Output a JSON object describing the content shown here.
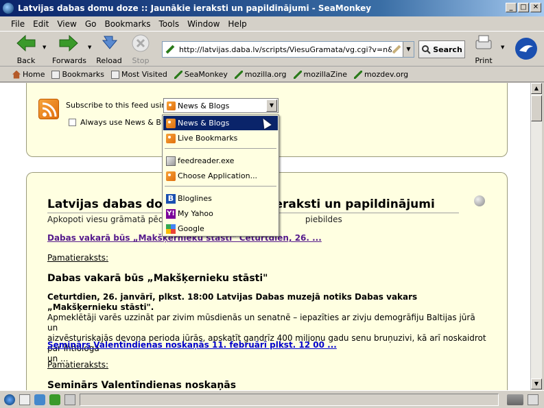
{
  "window": {
    "title": "Latvijas dabas domu doze :: Jaunākie ieraksti un papildinājumi - SeaMonkey"
  },
  "menu": [
    "File",
    "Edit",
    "View",
    "Go",
    "Bookmarks",
    "Tools",
    "Window",
    "Help"
  ],
  "nav": {
    "back": "Back",
    "forward": "Forwards",
    "reload": "Reload",
    "stop": "Stop",
    "print": "Print"
  },
  "url": {
    "value": "http://latvijas.daba.lv/scripts/ViesuGramata/vg.cgi?v=n&s=d&R"
  },
  "search": {
    "label": "Search"
  },
  "bookmarks": [
    "Home",
    "Bookmarks",
    "Most Visited",
    "SeaMonkey",
    "mozilla.org",
    "mozillaZine",
    "mozdev.org"
  ],
  "feed": {
    "subscribe_label": "Subscribe to this feed using",
    "selected": "News & Blogs",
    "always_label": "Always use News & Blogs"
  },
  "dropdown": {
    "items": [
      "News & Blogs",
      "Live Bookmarks",
      "feedreader.exe",
      "Choose Application...",
      "Bloglines",
      "My Yahoo",
      "Google"
    ]
  },
  "page": {
    "title_left": "Latvijas dabas domu",
    "title_right": "ieraksti un papildinājumi",
    "subtitle_left": "Apkopoti viesu grāmatā pēdējie",
    "subtitle_right": "piebildes",
    "link1": "Dabas vakarā būs „Makšķernieku stāsti\" Ceturtdien, 26. ...",
    "main1": "Pamatieraksts:",
    "heading1": "Dabas vakarā būs „Makšķernieku stāsti\"",
    "para1_bold": "Ceturtdien, 26. janvārī, plkst. 18:00 Latvijas Dabas muzejā notiks Dabas vakars „Makšķernieku stāsti\".",
    "para1_line2": "Apmeklētāji varēs uzzināt par zivim mūsdienās un senatnē – iepazīties ar zivju demogrāfiju Baltijas jūrā un",
    "para1_line3": "aizvēsturiskajās devona perioda jūrās, apskatīt gandrīz 400 miljonu gadu senu bruņuzivi, kā arī noskaidrot par ihtiologa",
    "para1_line4": "un ...",
    "link2": "Seminārs Valentīndienas noskaņās 11. februārī plkst. 12 00 ...",
    "main2": "Pamatieraksts:",
    "heading2": "Seminārs Valentīndienas noskaņās"
  }
}
